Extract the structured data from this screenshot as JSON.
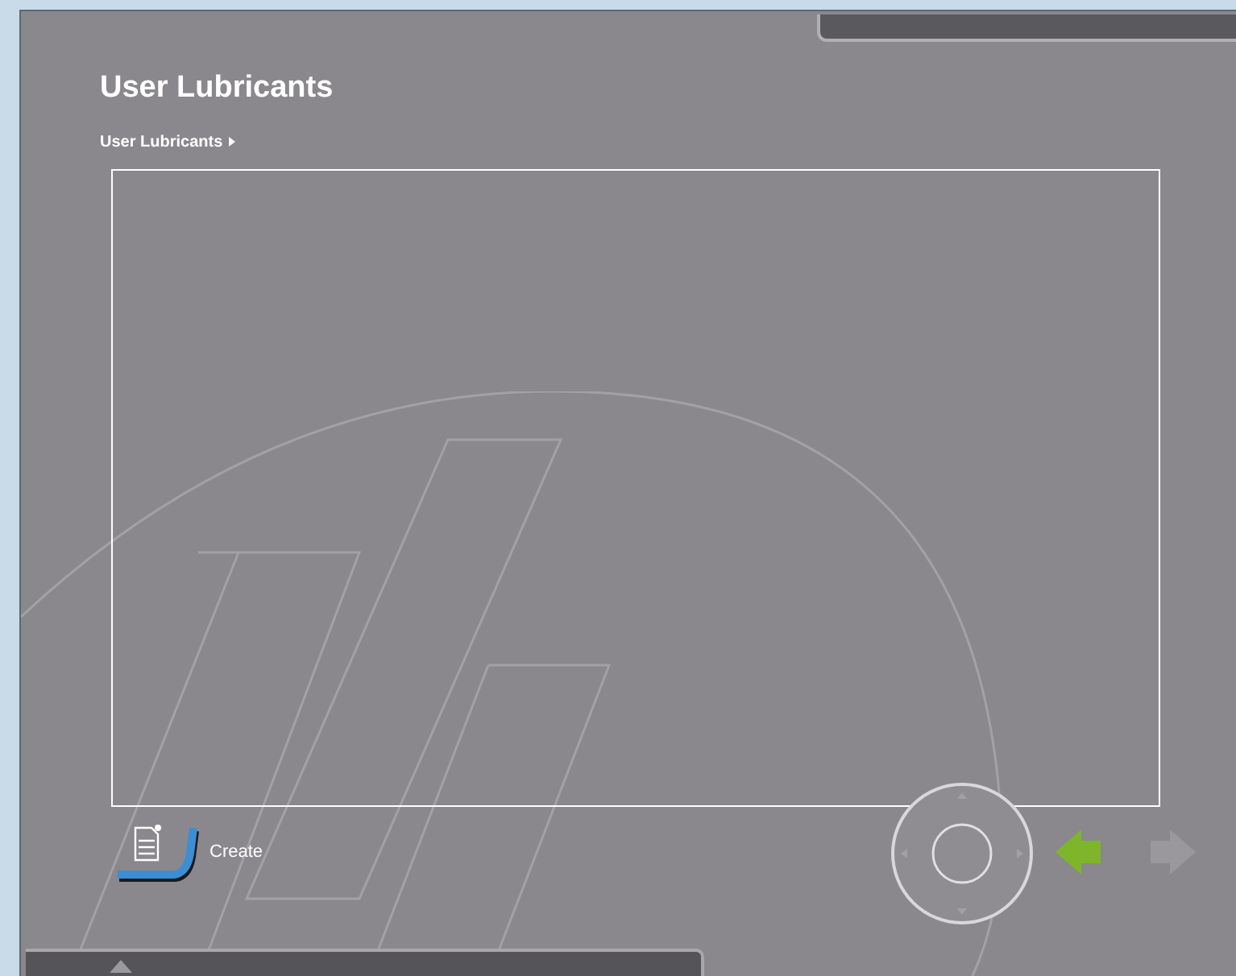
{
  "title": "User Lubricants",
  "breadcrumb": [
    {
      "label": "User Lubricants"
    }
  ],
  "create_button": {
    "label": "Create"
  },
  "navigation": {
    "back": {
      "disabled": false
    },
    "forward": {
      "disabled": true
    }
  }
}
